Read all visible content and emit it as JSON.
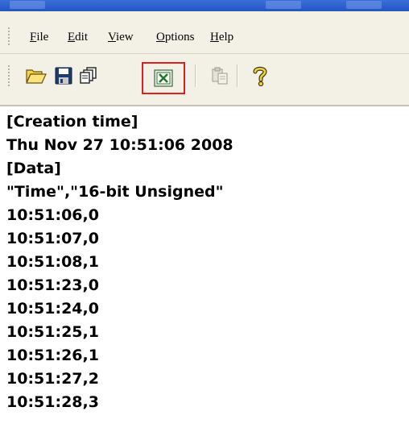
{
  "menu": {
    "items": [
      {
        "mnemonic": "F",
        "rest": "ile"
      },
      {
        "mnemonic": "E",
        "rest": "dit"
      },
      {
        "mnemonic": "V",
        "rest": "iew"
      },
      {
        "mnemonic": "O",
        "rest": "ptions"
      },
      {
        "mnemonic": "H",
        "rest": "elp"
      }
    ]
  },
  "toolbar": {
    "buttons": [
      {
        "icon": "open-folder-icon",
        "enabled": true
      },
      {
        "icon": "save-disk-icon",
        "enabled": true
      },
      {
        "icon": "copy-pages-icon",
        "enabled": true
      },
      {
        "icon": "excel-export-icon",
        "enabled": true,
        "highlighted": true
      },
      {
        "icon": "paste-icon",
        "enabled": false
      },
      {
        "icon": "help-question-icon",
        "enabled": true
      }
    ],
    "highlight_color": "#e02020"
  },
  "content": {
    "lines": [
      "[Creation time]",
      "Thu Nov 27 10:51:06 2008",
      "[Data]",
      "\"Time\",\"16-bit Unsigned\"",
      "10:51:06,0",
      "10:51:07,0",
      "10:51:08,1",
      "10:51:23,0",
      "10:51:24,0",
      "10:51:25,1",
      "10:51:26,1",
      "10:51:27,2",
      "10:51:28,3"
    ]
  }
}
